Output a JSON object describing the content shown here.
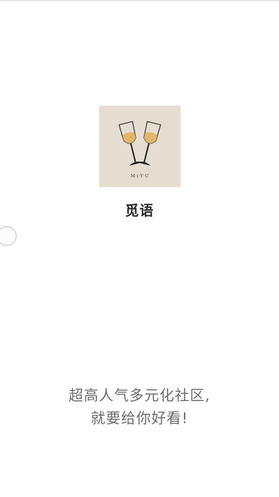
{
  "app": {
    "name": "觅语",
    "logo_caption": "M·i·Y·U"
  },
  "splash": {
    "slogan_line1": "超高人气多元化社区,",
    "slogan_line2": "就要给你好看!"
  },
  "colors": {
    "logo_background": "#e5ddd0",
    "wine": "#e2b56a",
    "slogan_text": "#6b6b6b"
  },
  "icons": {
    "logo": "clinking-wine-glasses-icon",
    "loading": "loading-spinner-icon"
  }
}
